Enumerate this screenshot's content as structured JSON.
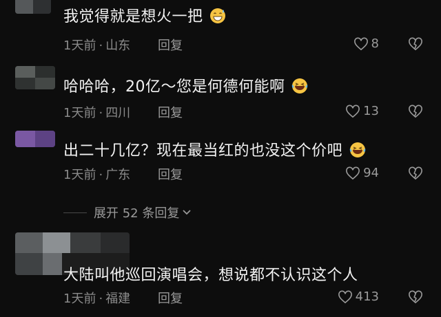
{
  "comments": [
    {
      "text": "我觉得就是想火一把",
      "emoji": "grinning-sweat-emoji",
      "age": "1天前",
      "sep": "·",
      "location": "山东",
      "reply": "回复",
      "likes": "8"
    },
    {
      "text": "哈哈哈，20亿～您是何德何能啊",
      "emoji": "laughing-tears-emoji",
      "age": "1天前",
      "sep": "·",
      "location": "四川",
      "reply": "回复",
      "likes": "13"
    },
    {
      "text": "出二十几亿？现在最当红的也没这个价吧",
      "emoji": "laughing-tears-emoji",
      "age": "1天前",
      "sep": "·",
      "location": "广东",
      "reply": "回复",
      "likes": "94"
    },
    {
      "text": "大陆叫他巡回演唱会，想说都不认识这个人",
      "emoji": "",
      "age": "1天前",
      "sep": "·",
      "location": "福建",
      "reply": "回复",
      "likes": "413"
    }
  ],
  "expand": {
    "label": "展开 52 条回复"
  },
  "colors": {
    "background": "#0d0d0d",
    "text": "#f2f2f2",
    "muted": "#8a8a8a"
  },
  "icons": [
    "heart-outline-icon",
    "broken-heart-icon",
    "chevron-down-icon"
  ]
}
